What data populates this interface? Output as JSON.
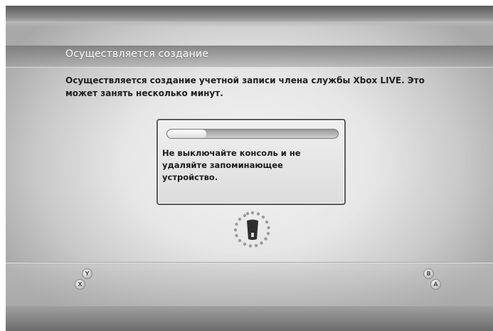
{
  "screen": {
    "title": "Осуществляется создание",
    "message": "Осуществляется создание учетной записи члена службы Xbox LIVE. Это может занять несколько минут."
  },
  "dialog": {
    "progress_fraction": 0.23,
    "warning": "Не выключайте консоль и не удаляйте запоминающее устройство."
  },
  "loading_indicator": {
    "icon": "xbox-loading-icon"
  },
  "controller_buttons": {
    "y": "Y",
    "x": "X",
    "b": "B",
    "a": "A"
  },
  "colors": {
    "title_text": "#ffffff",
    "body_text": "#202020",
    "dialog_border": "#5a5a5a"
  }
}
